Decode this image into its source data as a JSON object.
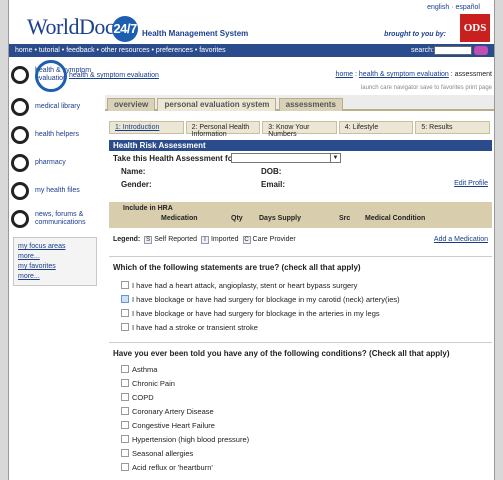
{
  "header": {
    "logo_text": "WorldDoc",
    "logo_badge": "24/7",
    "tagline": "Health Management System",
    "top_links": "english · español",
    "brought_by": "brought to you by:",
    "sponsor": "ODS"
  },
  "nav": {
    "links": "home • tutorial • feedback • other resources • preferences • favorites",
    "search_label": "search:"
  },
  "sidebar": {
    "items": [
      {
        "label": "health & symptom evaluation",
        "icon": "stethoscope-icon"
      },
      {
        "label": "medical library",
        "icon": "library-icon"
      },
      {
        "label": "health helpers",
        "icon": "helper-icon"
      },
      {
        "label": "pharmacy",
        "icon": "pharmacy-icon"
      },
      {
        "label": "my health files",
        "icon": "files-icon"
      },
      {
        "label": "news, forums & communications",
        "icon": "news-icon"
      }
    ],
    "focus_link": "my focus areas",
    "more1": "more...",
    "favorites_link": "my favorites",
    "more2": "more..."
  },
  "crumb": {
    "title": "health & symptom evaluation",
    "home": "home",
    "section": "health & symptom evaluation",
    "current": "assessment",
    "tools": "launch care navigator  save to favorites  print page"
  },
  "tabs": [
    "overview",
    "personal evaluation system",
    "assessments"
  ],
  "steps": [
    "1: Introduction",
    "2: Personal Health Information",
    "3: Know Your Numbers",
    "4: Lifestyle",
    "5: Results"
  ],
  "hra": {
    "bar_title": "Health Risk Assessment",
    "take_for": "Take this Health Assessment for:",
    "name": "Name:",
    "dob": "DOB:",
    "gender": "Gender:",
    "email": "Email:",
    "edit_profile": "Edit Profile"
  },
  "med_cols": [
    "Include in HRA",
    "Medication",
    "Qty",
    "Days Supply",
    "Src",
    "Medical Condition"
  ],
  "legend": {
    "label": "Legend:",
    "self": "Self Reported",
    "imported": "Imported",
    "care": "Care Provider",
    "add": "Add a Medication"
  },
  "q1": {
    "text": "Which of the following statements are true? (check all that apply)",
    "options": [
      "I have had a heart attack, angioplasty, stent or heart bypass surgery",
      "I have blockage or have had surgery for blockage in my carotid (neck) artery(ies)",
      "I have blockage or have had surgery for blockage in the arteries in my legs",
      "I have had a stroke or transient stroke"
    ]
  },
  "q2": {
    "text": "Have you ever been told you have any of the following conditions? (Check all that apply)",
    "options": [
      "Asthma",
      "Chronic Pain",
      "COPD",
      "Coronary Artery Disease",
      "Congestive Heart Failure",
      "Hypertension (high blood pressure)",
      "Seasonal allergies",
      "Acid reflux or 'heartburn'"
    ]
  }
}
